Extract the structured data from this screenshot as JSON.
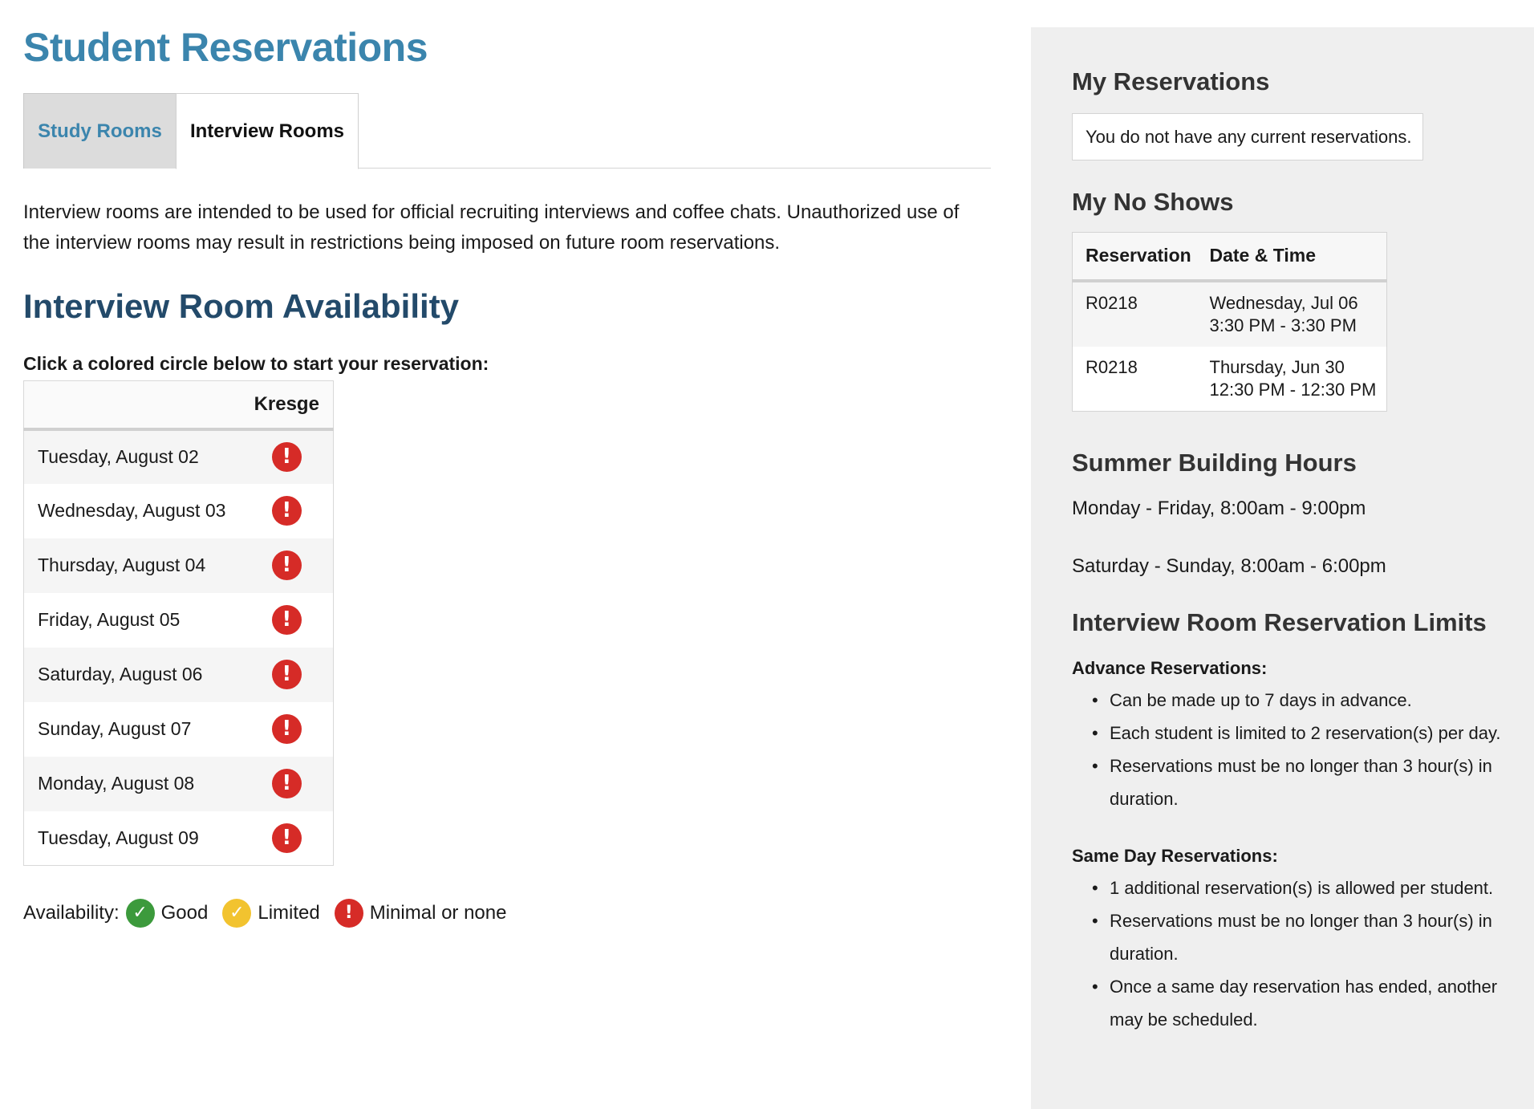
{
  "page": {
    "title": "Student Reservations",
    "tabs": [
      {
        "label": "Study Rooms",
        "active": false
      },
      {
        "label": "Interview Rooms",
        "active": true
      }
    ],
    "intro": "Interview rooms are intended to be used for official recruiting interviews and coffee chats. Unauthorized use of the interview rooms may result in restrictions being imposed on future room reservations.",
    "section_title": "Interview Room Availability",
    "instruction": "Click a colored circle below to start your reservation:"
  },
  "availability": {
    "column_header": "Kresge",
    "rows": [
      {
        "date": "Tuesday, August 02",
        "status": "minimal"
      },
      {
        "date": "Wednesday, August 03",
        "status": "minimal"
      },
      {
        "date": "Thursday, August 04",
        "status": "minimal"
      },
      {
        "date": "Friday, August 05",
        "status": "minimal"
      },
      {
        "date": "Saturday, August 06",
        "status": "minimal"
      },
      {
        "date": "Sunday, August 07",
        "status": "minimal"
      },
      {
        "date": "Monday, August 08",
        "status": "minimal"
      },
      {
        "date": "Tuesday, August 09",
        "status": "minimal"
      }
    ],
    "status_colors": {
      "good": "#3c9a3c",
      "limited": "#f2c32f",
      "minimal": "#d62b27"
    }
  },
  "legend": {
    "prefix": "Availability:",
    "good": "Good",
    "limited": "Limited",
    "minimal": "Minimal or none"
  },
  "sidebar": {
    "my_reservations": {
      "title": "My Reservations",
      "empty_text": "You do not have any current reservations."
    },
    "no_shows": {
      "title": "My No Shows",
      "headers": [
        "Reservation",
        "Date & Time"
      ],
      "rows": [
        {
          "id": "R0218",
          "date": "Wednesday, Jul 06",
          "time": "3:30 PM - 3:30 PM"
        },
        {
          "id": "R0218",
          "date": "Thursday, Jun 30",
          "time": "12:30 PM - 12:30 PM"
        }
      ]
    },
    "building_hours": {
      "title": "Summer Building Hours",
      "weekday": "Monday - Friday, 8:00am - 9:00pm",
      "weekend": "Saturday - Sunday, 8:00am - 6:00pm"
    },
    "limits": {
      "title": "Interview Room Reservation Limits",
      "advance_title": "Advance Reservations:",
      "advance_items": [
        "Can be made up to 7 days in advance.",
        "Each student is limited to 2 reservation(s) per day.",
        "Reservations must be no longer than 3 hour(s) in duration."
      ],
      "same_day_title": "Same Day Reservations:",
      "same_day_items": [
        "1 additional reservation(s) is allowed per student.",
        "Reservations must be no longer than 3 hour(s) in duration.",
        "Once a same day reservation has ended, another may be scheduled."
      ]
    }
  }
}
